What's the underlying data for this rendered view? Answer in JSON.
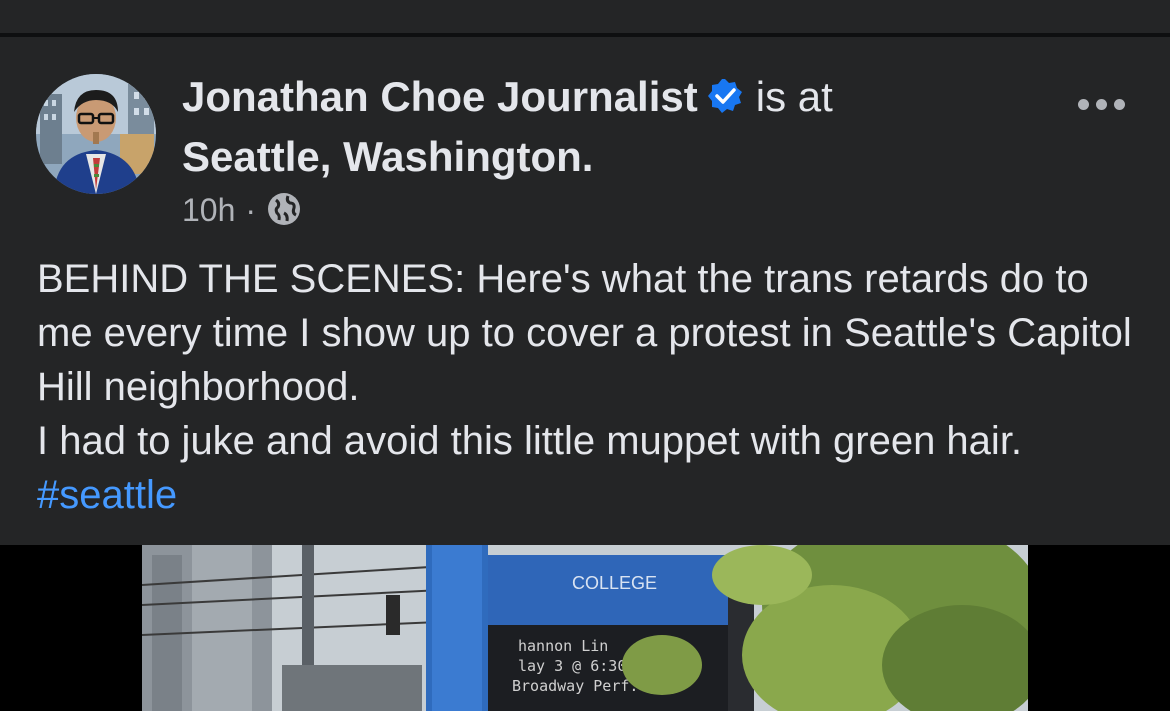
{
  "post": {
    "author": "Jonathan Choe Journalist",
    "verb": "is at",
    "location": "Seattle, Washington.",
    "time": "10h",
    "separator": "·",
    "body_lines": [
      "BEHIND THE SCENES: Here's what the trans retards do to me every time I show up to cover a protest in Seattle's Capitol Hill neighborhood.",
      "I had to juke and avoid this little muppet with green hair."
    ],
    "hashtag": "#seattle"
  },
  "media": {
    "sign": {
      "college": "COLLEGE",
      "line1": "hannon Lin",
      "line2": "lay 3 @ 6:30 P.M.",
      "line3": "Broadway Perf. Hall"
    }
  },
  "icons": {
    "verified": "verified-badge-icon",
    "privacy": "globe-icon",
    "menu": "more-options-icon"
  },
  "colors": {
    "background": "#242526",
    "text": "#e4e6eb",
    "secondary": "#b0b3b8",
    "link": "#4599ff",
    "verified": "#1877f2"
  }
}
